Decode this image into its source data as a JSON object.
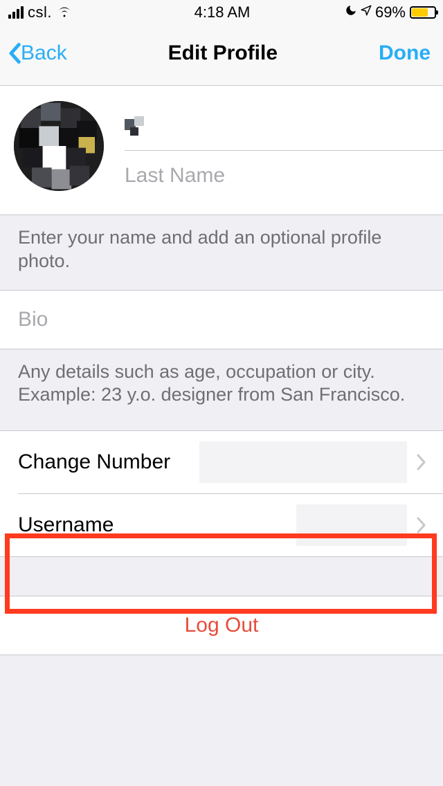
{
  "status_bar": {
    "carrier": "csl.",
    "time": "4:18 AM",
    "battery_percent": "69%"
  },
  "nav": {
    "back_label": "Back",
    "title": "Edit Profile",
    "done_label": "Done"
  },
  "name": {
    "first_name_value": "",
    "last_name_value": "",
    "last_name_placeholder": "Last Name"
  },
  "hints": {
    "name_hint": "Enter your name and add an optional profile photo.",
    "bio_placeholder": "Bio",
    "bio_hint": "Any details such as age, occupation or city. Example: 23 y.o. designer from San Francisco."
  },
  "rows": {
    "change_number_label": "Change Number",
    "change_number_value": "",
    "username_label": "Username",
    "username_value": ""
  },
  "logout_label": "Log Out",
  "highlight": {
    "target": "username-row"
  }
}
